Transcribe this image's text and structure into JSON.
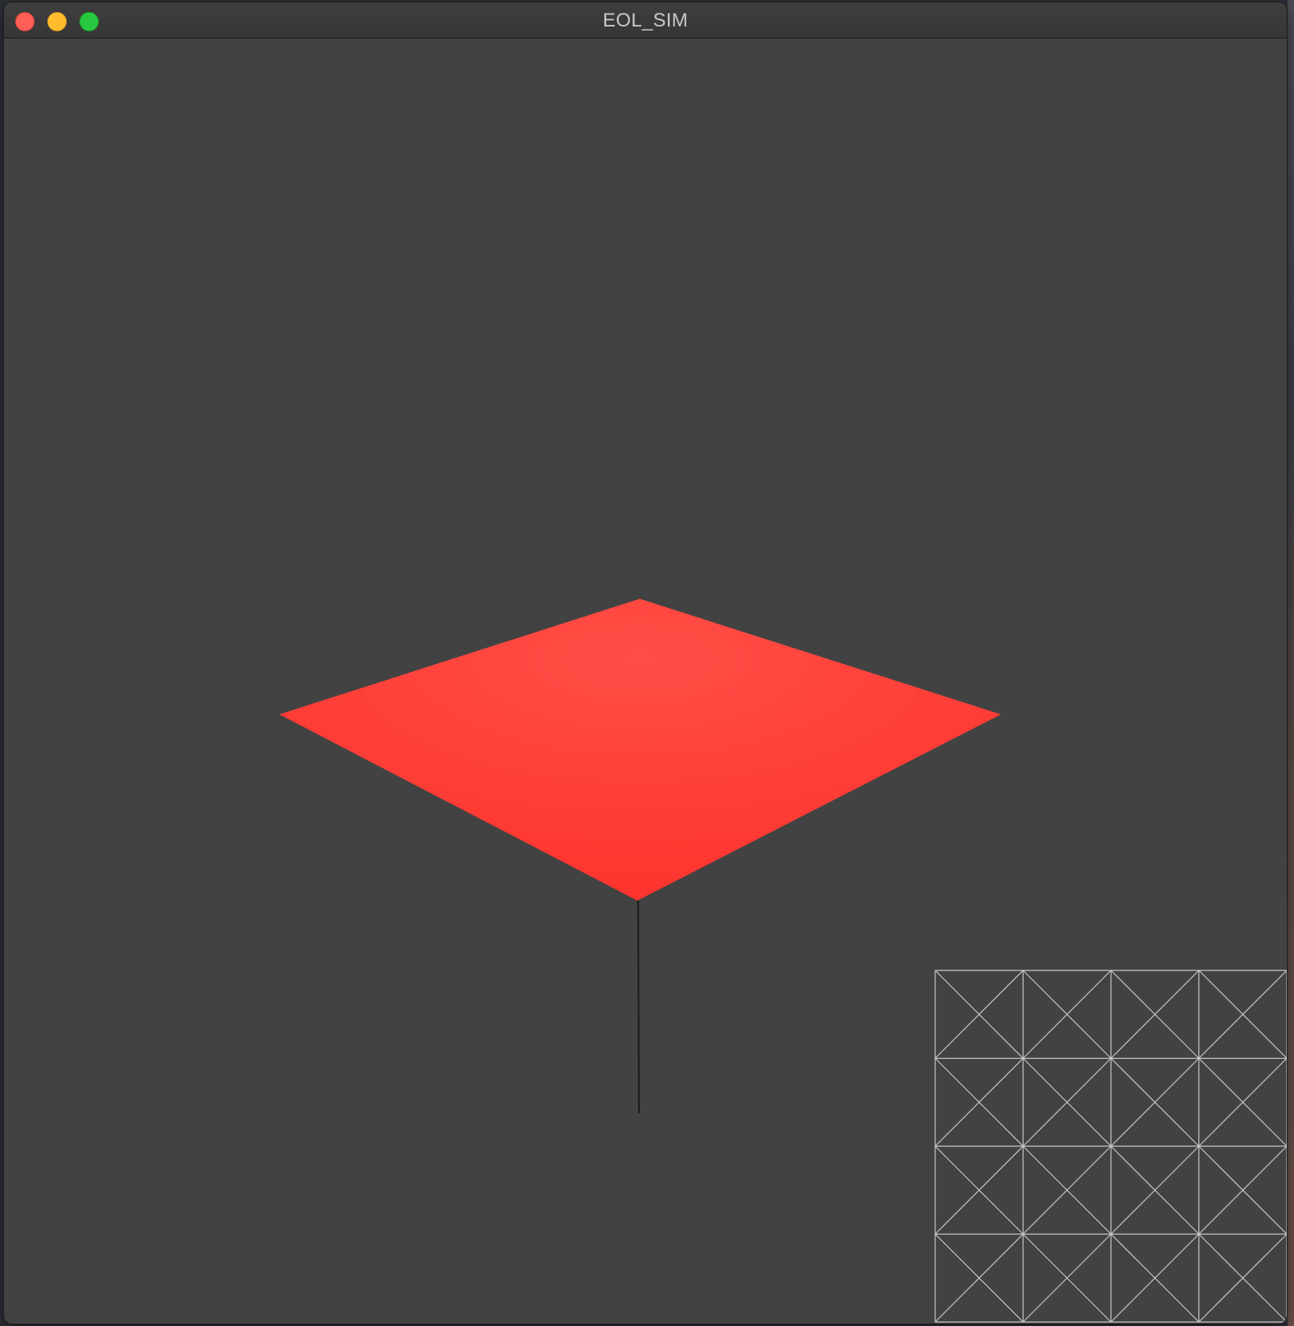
{
  "window": {
    "title": "EOL_SIM",
    "controls": {
      "close": "close-button",
      "minimize": "minimize-button",
      "maximize": "maximize-button"
    }
  },
  "scene": {
    "cloth_color": "#ff3a34",
    "cloth_highlight": "#ff5048",
    "background_color": "#424242",
    "rod_color": "#1a1a1a",
    "mesh_line_color": "#c8c8c8",
    "mesh_grid_divisions": 4
  }
}
